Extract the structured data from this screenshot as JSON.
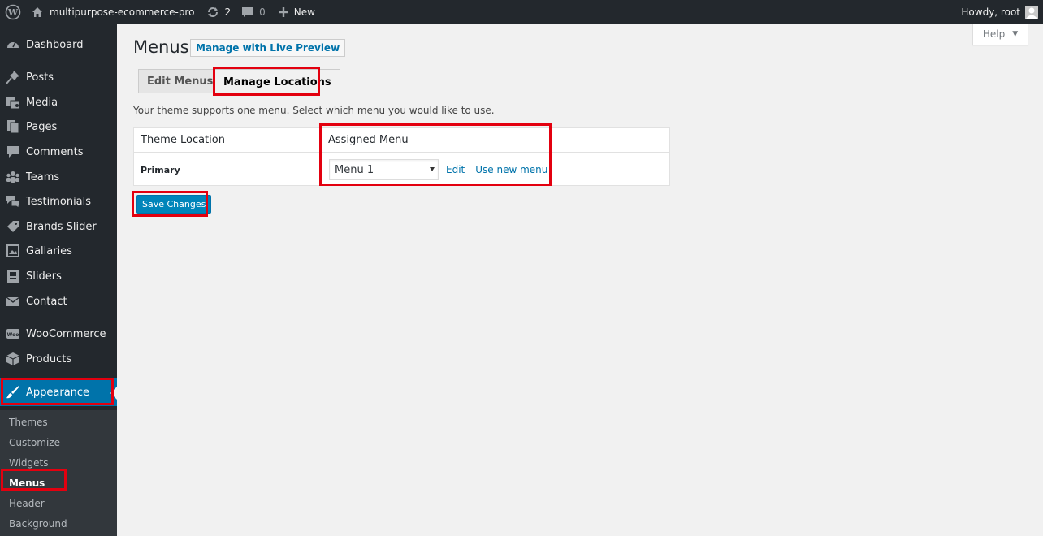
{
  "adminbar": {
    "site_name": "multipurpose-ecommerce-pro",
    "updates_count": "2",
    "comments_count": "0",
    "new_label": "New",
    "greeting": "Howdy, root"
  },
  "sidebar": {
    "items": [
      {
        "label": "Dashboard",
        "icon": "dashboard-icon"
      },
      {
        "label": "Posts",
        "icon": "pin-icon"
      },
      {
        "label": "Media",
        "icon": "media-icon"
      },
      {
        "label": "Pages",
        "icon": "pages-icon"
      },
      {
        "label": "Comments",
        "icon": "comment-icon"
      },
      {
        "label": "Teams",
        "icon": "groups-icon"
      },
      {
        "label": "Testimonials",
        "icon": "testimonial-icon"
      },
      {
        "label": "Brands Slider",
        "icon": "tag-icon"
      },
      {
        "label": "Gallaries",
        "icon": "gallery-icon"
      },
      {
        "label": "Sliders",
        "icon": "slides-icon"
      },
      {
        "label": "Contact",
        "icon": "email-icon"
      },
      {
        "label": "WooCommerce",
        "icon": "woo-icon"
      },
      {
        "label": "Products",
        "icon": "archive-icon"
      },
      {
        "label": "Appearance",
        "icon": "paintbrush-icon"
      }
    ],
    "submenu": [
      "Themes",
      "Customize",
      "Widgets",
      "Menus",
      "Header",
      "Background"
    ]
  },
  "help_tab": {
    "label": "Help"
  },
  "page": {
    "title": "Menus",
    "preview_button": "Manage with Live Preview",
    "tabs": [
      "Edit Menus",
      "Manage Locations"
    ],
    "intro": "Your theme supports one menu. Select which menu you would like to use."
  },
  "locations_table": {
    "headers": [
      "Theme Location",
      "Assigned Menu"
    ],
    "row": {
      "location": "Primary",
      "selected_menu": "Menu 1",
      "edit_link": "Edit",
      "new_menu_link": "Use new menu"
    }
  },
  "save_button": "Save Changes",
  "colors": {
    "adminbar_bg": "#23282d",
    "accent": "#0073aa",
    "highlight": "#e3000f"
  }
}
